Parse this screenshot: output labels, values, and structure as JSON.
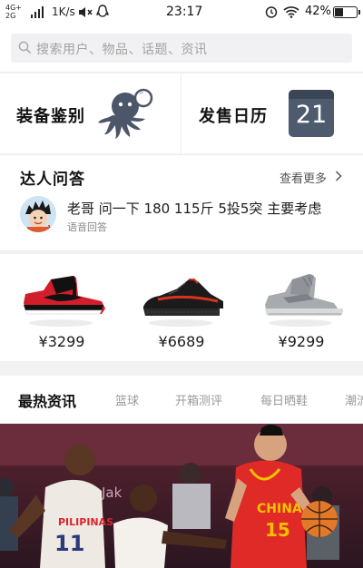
{
  "status_bar": {
    "network_top": "4G+",
    "network_bottom": "2G",
    "speed": "1K/s",
    "time": "23:17",
    "battery_percent": "42%",
    "battery_level": 0.42,
    "icons": [
      "signal-icon",
      "mute-icon",
      "qq-icon",
      "alarm-icon",
      "wifi-icon",
      "battery-icon"
    ]
  },
  "search": {
    "placeholder": "搜索用户、物品、话题、资讯"
  },
  "features": [
    {
      "title": "装备鉴别",
      "icon": "octopus-magnifier-icon"
    },
    {
      "title": "发售日历",
      "icon": "calendar-icon",
      "calendar_day": "21"
    }
  ],
  "qa": {
    "title": "达人问答",
    "more": "查看更多",
    "question": "老哥 问一下 180 115斤 5投5突 主要考虑",
    "answer_type": "语音回答"
  },
  "products": [
    {
      "price": "¥3299",
      "image": "red-black-high-top-sneaker"
    },
    {
      "price": "¥6689",
      "image": "black-red-knit-sneaker"
    },
    {
      "price": "¥9299",
      "image": "grey-high-top-sneaker"
    }
  ],
  "hot_news": {
    "title": "最热资讯",
    "tabs": [
      "篮球",
      "开箱测评",
      "每日晒鞋",
      "潮流"
    ]
  },
  "banner": {
    "image": "basketball-game-photo",
    "jersey_text_1": "CHINA",
    "jersey_number_1": "15",
    "jersey_text_2": "PILIPINAS",
    "jersey_number_2": "11",
    "background_text": "Jak"
  },
  "colors": {
    "accent_red": "#d8262e",
    "muted_text": "#9a9a9a",
    "background": "#f2f2f2"
  }
}
